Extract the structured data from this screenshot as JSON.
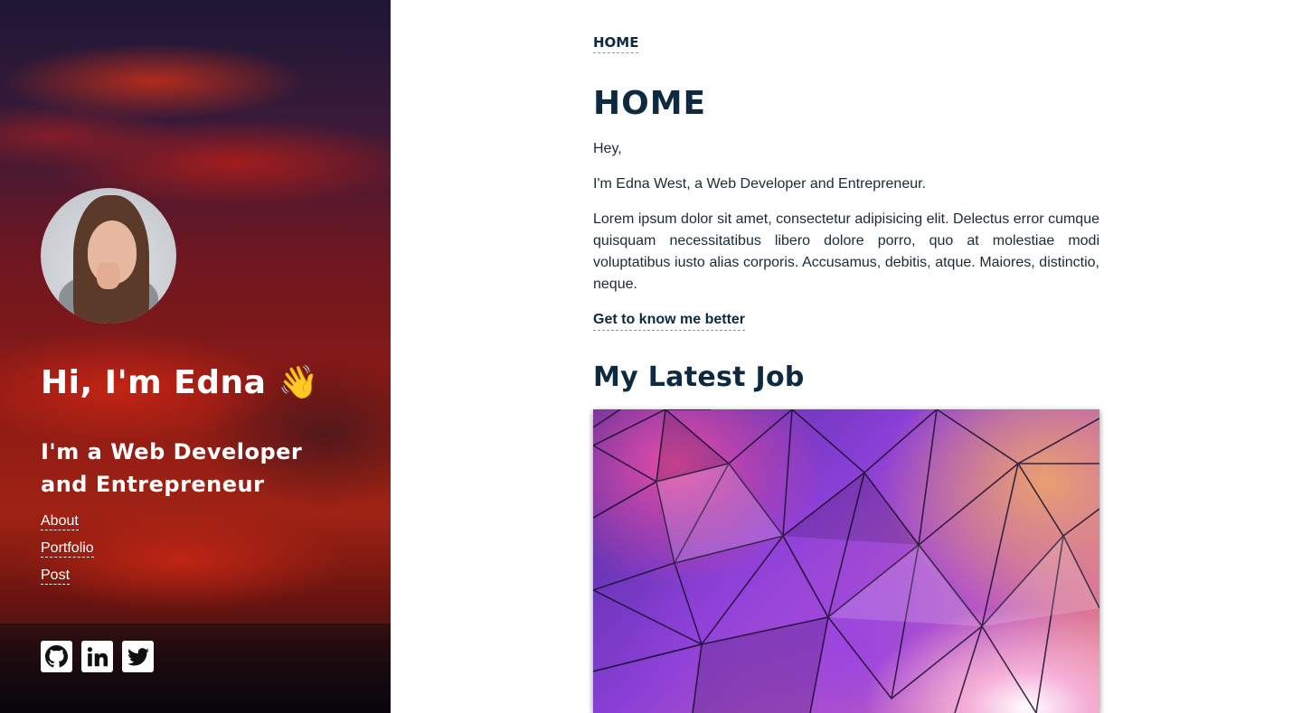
{
  "sidebar": {
    "greeting": "Hi, I'm Edna 👋",
    "tagline": "I'm a Web Developer and Entrepreneur",
    "nav": [
      {
        "label": "About"
      },
      {
        "label": "Portfolio"
      },
      {
        "label": "Post"
      }
    ],
    "social": [
      {
        "icon": "github-icon"
      },
      {
        "icon": "linkedin-icon"
      },
      {
        "icon": "twitter-icon"
      }
    ]
  },
  "main": {
    "breadcrumb": "HOME",
    "title": "HOME",
    "paragraphs": [
      "Hey,",
      "I'm Edna West, a Web Developer and Entrepreneur.",
      "Lorem ipsum dolor sit amet, consectetur adipisicing elit. Delectus error cumque quisquam necessitatibus libero dolore porro, quo at molestiae modi voluptatibus iusto alias corporis. Accusamus, debitis, atque. Maiores, distinctio, neque."
    ],
    "more_link": "Get to know me better",
    "section_title": "My Latest Job"
  },
  "colors": {
    "heading": "#0e2a40",
    "text": "#1b2a38",
    "sidebar_text": "#ffffff"
  }
}
